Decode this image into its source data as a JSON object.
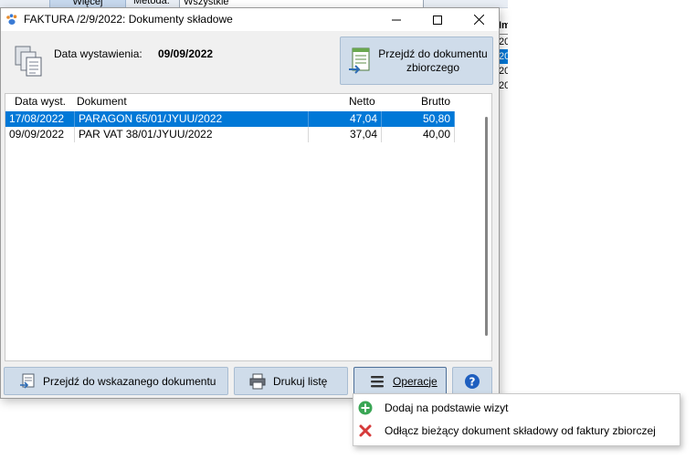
{
  "background": {
    "more_button": "Więcej",
    "method_label": "Metoda:",
    "method_value": "Wszystkie",
    "list_header": "Im",
    "list_rows": [
      "20",
      "20",
      "20",
      "20"
    ]
  },
  "window": {
    "title": "FAKTURA /2/9/2022: Dokumenty składowe"
  },
  "header": {
    "date_label": "Data wystawienia:",
    "date_value": "09/09/2022",
    "goto_summary_line1": "Przejdź do dokumentu",
    "goto_summary_line2": "zbiorczego"
  },
  "table": {
    "columns": {
      "date": "Data wyst.",
      "document": "Dokument",
      "net": "Netto",
      "gross": "Brutto"
    },
    "rows": [
      {
        "date": "17/08/2022",
        "document": "PARAGON 65/01/JYUU/2022",
        "net": "47,04",
        "gross": "50,80"
      },
      {
        "date": "09/09/2022",
        "document": "PAR VAT 38/01/JYUU/2022",
        "net": "37,04",
        "gross": "40,00"
      }
    ]
  },
  "footer": {
    "goto_label": "Przejdź do wskazanego dokumentu",
    "print_label": "Drukuj listę",
    "operations_label": "Operacje"
  },
  "menu": {
    "add_label": "Dodaj na podstawie wizyt",
    "detach_label": "Odłącz bieżący dokument składowy od faktury zbiorczej"
  },
  "colors": {
    "selection": "#0078d7",
    "button_bg": "#cfdcea",
    "add_green": "#3aa655",
    "remove_red": "#d63b3b",
    "help_blue": "#1f5fbf"
  }
}
